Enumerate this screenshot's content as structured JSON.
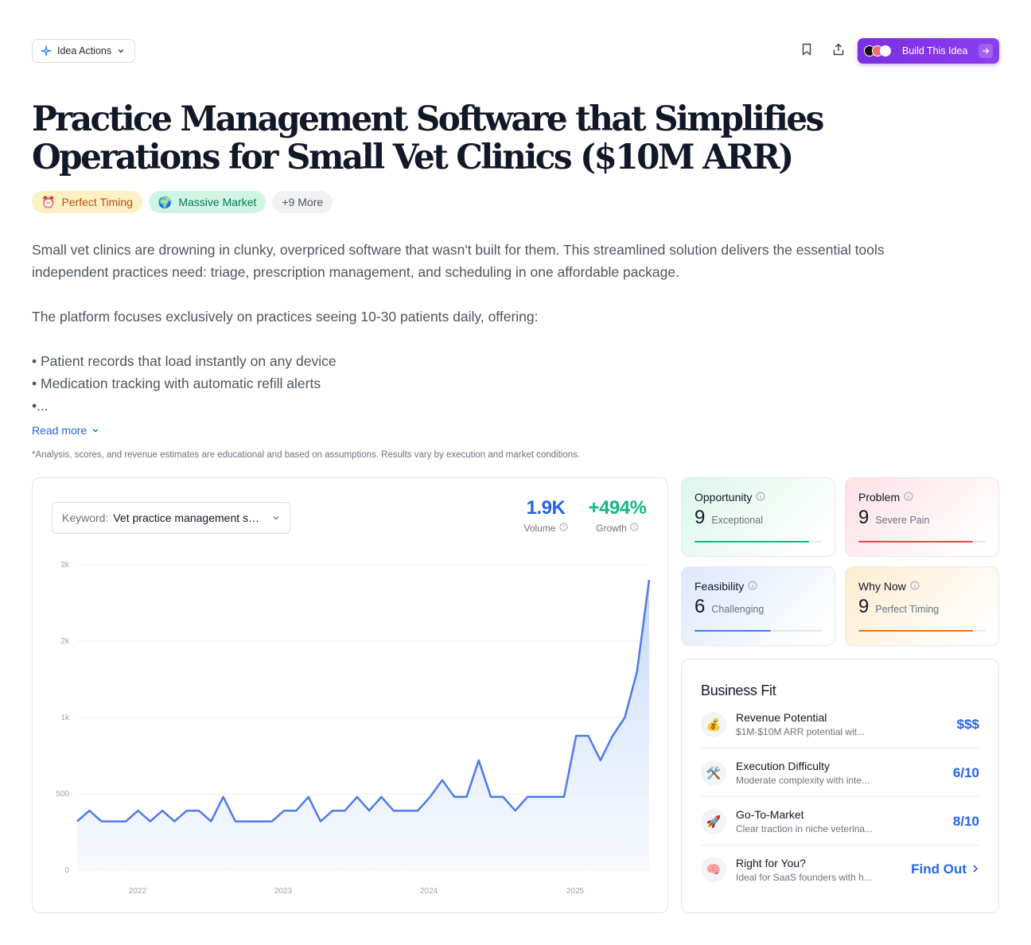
{
  "header": {
    "idea_actions_label": "Idea Actions",
    "build_label": "Build This Idea"
  },
  "title": "Practice Management Software that Simplifies Operations for Small Vet Clinics ($10M ARR)",
  "tags": [
    {
      "label": "Perfect Timing",
      "icon": "⏰"
    },
    {
      "label": "Massive Market",
      "icon": "🌍"
    },
    {
      "label": "+9 More"
    }
  ],
  "description": {
    "p1": "Small vet clinics are drowning in clunky, overpriced software that wasn't built for them. This streamlined solution delivers the essential tools independent practices need: triage, prescription management, and scheduling in one affordable package.",
    "p2": "The platform focuses exclusively on practices seeing 10-30 patients daily, offering:",
    "bullet1": "• Patient records that load instantly on any device",
    "bullet2": "• Medication tracking with automatic refill alerts",
    "bullet3": "•..."
  },
  "read_more_label": "Read more",
  "disclaimer": "*Analysis, scores, and revenue estimates are educational and based on assumptions. Results vary by execution and market conditions.",
  "keyword": {
    "label": "Keyword:",
    "value": "Vet practice management software"
  },
  "stats": {
    "volume_value": "1.9K",
    "volume_label": "Volume",
    "growth_value": "+494%",
    "growth_label": "Growth"
  },
  "chart_data": {
    "type": "area",
    "y_ticks": [
      "0",
      "500",
      "1k",
      "2k",
      "2k"
    ],
    "x_ticks": [
      "2022",
      "2023",
      "2024",
      "2025"
    ],
    "ylim": [
      0,
      2000
    ],
    "grid": true,
    "color": "#4f7ae8",
    "values": [
      320,
      390,
      320,
      320,
      320,
      390,
      320,
      390,
      320,
      390,
      390,
      320,
      480,
      320,
      320,
      320,
      320,
      390,
      390,
      480,
      320,
      390,
      390,
      480,
      390,
      480,
      390,
      390,
      390,
      480,
      590,
      480,
      480,
      720,
      480,
      480,
      390,
      480,
      480,
      480,
      480,
      880,
      880,
      720,
      880,
      1000,
      1300,
      1900
    ]
  },
  "scores": [
    {
      "title": "Opportunity",
      "score": "9",
      "sub": "Exceptional",
      "fill": 0.9,
      "color": "#10b981"
    },
    {
      "title": "Problem",
      "score": "9",
      "sub": "Severe Pain",
      "fill": 0.9,
      "color": "#ef4444"
    },
    {
      "title": "Feasibility",
      "score": "6",
      "sub": "Challenging",
      "fill": 0.6,
      "color": "#3b82f6"
    },
    {
      "title": "Why Now",
      "score": "9",
      "sub": "Perfect Timing",
      "fill": 0.9,
      "color": "#f97316"
    }
  ],
  "business_fit": {
    "title": "Business Fit",
    "rows": [
      {
        "icon": "💰",
        "name": "Revenue Potential",
        "sub": "$1M-$10M ARR potential wit...",
        "value": "$$$"
      },
      {
        "icon": "🛠️",
        "name": "Execution Difficulty",
        "sub": "Moderate complexity with inte...",
        "value": "6/10"
      },
      {
        "icon": "🚀",
        "name": "Go-To-Market",
        "sub": "Clear traction in niche veterina...",
        "value": "8/10"
      },
      {
        "icon": "🧠",
        "name": "Right for You?",
        "sub": "Ideal for SaaS founders with h...",
        "value": "Find Out"
      }
    ]
  }
}
